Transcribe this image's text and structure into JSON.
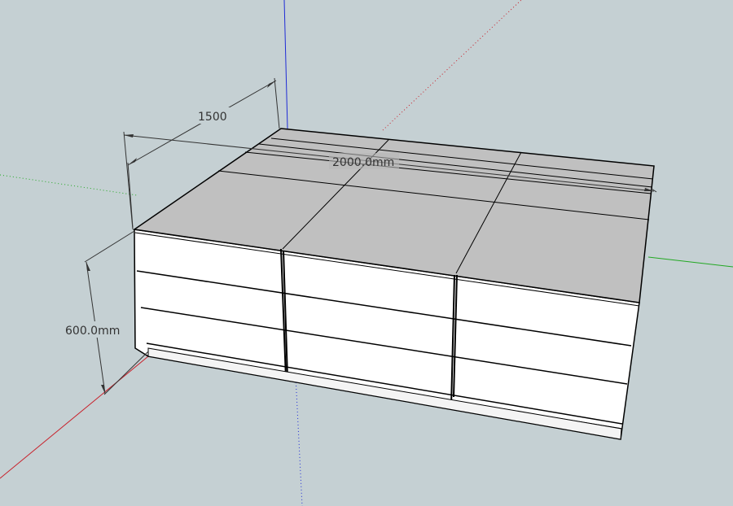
{
  "model_viewport": {
    "background": "#c5d0d3",
    "axis_colors": {
      "red": "#c8202a",
      "green": "#22a822",
      "blue": "#1f2bd6"
    },
    "dimensions": {
      "depth_label": "1500",
      "width_label": "2000.0mm",
      "height_label": "600.0mm"
    },
    "cabinet": {
      "top_color": "#c0c0c0",
      "front_color": "#ffffff",
      "edge_color": "#000000"
    }
  }
}
